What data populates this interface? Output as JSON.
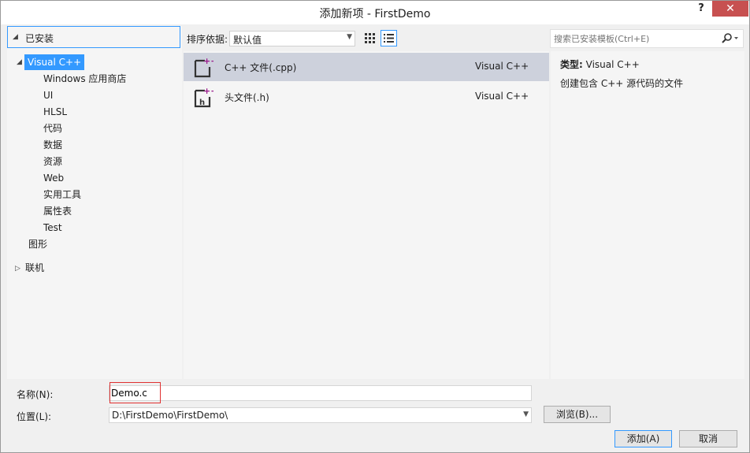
{
  "window": {
    "title": "添加新项 - FirstDemo",
    "help_label": "?",
    "close_label": "✕"
  },
  "tree": {
    "header": "已安装",
    "items": [
      {
        "label": "Visual C++",
        "level": 0,
        "selected": true,
        "expanded": true
      },
      {
        "label": "Windows 应用商店",
        "level": 1
      },
      {
        "label": "UI",
        "level": 1
      },
      {
        "label": "HLSL",
        "level": 1
      },
      {
        "label": "代码",
        "level": 1
      },
      {
        "label": "数据",
        "level": 1
      },
      {
        "label": "资源",
        "level": 1
      },
      {
        "label": "Web",
        "level": 1
      },
      {
        "label": "实用工具",
        "level": 1
      },
      {
        "label": "属性表",
        "level": 1
      },
      {
        "label": "Test",
        "level": 1
      },
      {
        "label": "图形",
        "level": 0
      }
    ],
    "online": "联机"
  },
  "toolbar": {
    "sort_label": "排序依据:",
    "sort_value": "默认值"
  },
  "templates": [
    {
      "name": "C++ 文件(.cpp)",
      "type": "Visual C++",
      "selected": true
    },
    {
      "name": "头文件(.h)",
      "type": "Visual C++",
      "selected": false
    }
  ],
  "search": {
    "placeholder": "搜索已安装模板(Ctrl+E)"
  },
  "details": {
    "type_label": "类型:",
    "type_value": "Visual C++",
    "description": "创建包含 C++ 源代码的文件"
  },
  "form": {
    "name_label": "名称(N):",
    "name_value": "Demo.c",
    "location_label": "位置(L):",
    "location_value": "D:\\FirstDemo\\FirstDemo\\",
    "browse_label": "浏览(B)...",
    "add_label": "添加(A)",
    "cancel_label": "取消"
  },
  "colors": {
    "accent": "#3399ff",
    "selected_row": "#cdd1dc",
    "close_button": "#c75050",
    "highlight_box": "#e03030",
    "icon_accent": "#9b1a8c"
  }
}
